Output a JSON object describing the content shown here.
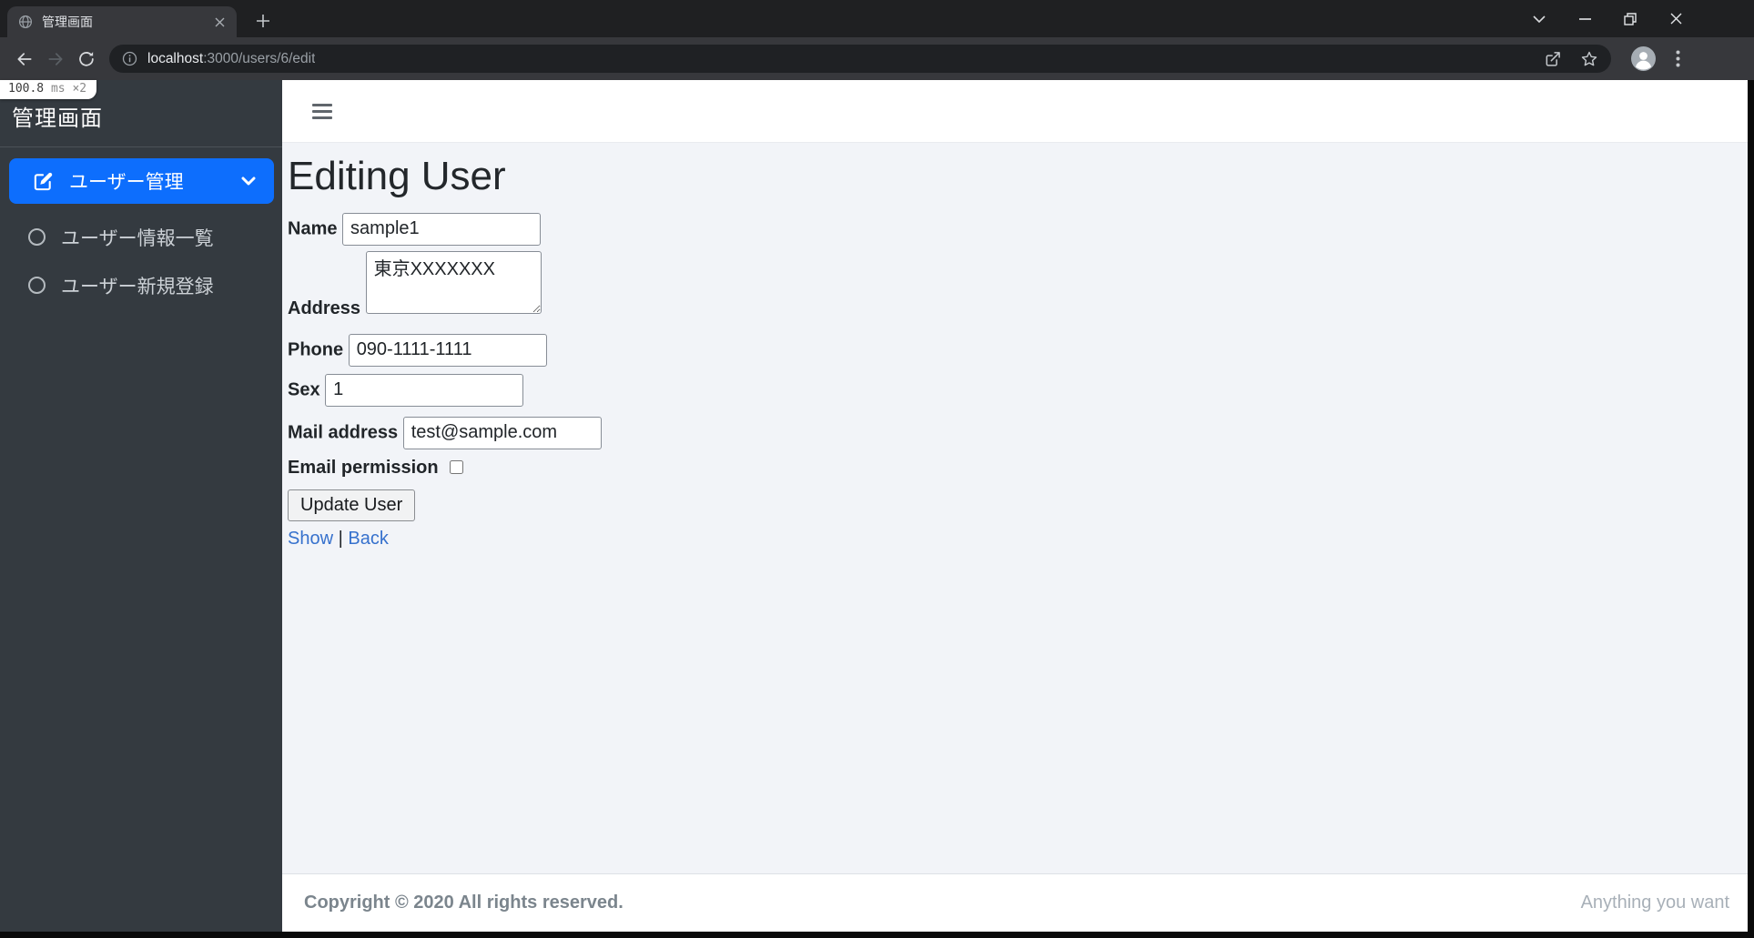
{
  "browser": {
    "tab_title": "管理画面",
    "url_host": "localhost",
    "url_path": ":3000/users/6/edit"
  },
  "profiler": {
    "time": "100.8",
    "unit": "ms",
    "count": "×2"
  },
  "sidebar": {
    "brand": "管理画面",
    "nav": [
      {
        "label": "ユーザー管理"
      },
      {
        "label": "ユーザー情報一覧"
      },
      {
        "label": "ユーザー新規登録"
      }
    ]
  },
  "main": {
    "title": "Editing User",
    "form": {
      "name_label": "Name",
      "name_value": "sample1",
      "address_label": "Address",
      "address_value": "東京XXXXXXX",
      "phone_label": "Phone",
      "phone_value": "090-1111-1111",
      "sex_label": "Sex",
      "sex_value": "1",
      "mail_label": "Mail address",
      "mail_value": "test@sample.com",
      "permission_label": "Email permission",
      "submit_label": "Update User"
    },
    "links": {
      "show": "Show",
      "separator": "|",
      "back": "Back"
    }
  },
  "footer": {
    "copyright": "Copyright © 2020 All rights reserved.",
    "tagline": "Anything you want"
  },
  "colors": {
    "accent_blue": "#0d6efd",
    "link_blue": "#3671cd",
    "sidebar_bg": "#343a40",
    "content_bg": "#f2f4f8"
  }
}
